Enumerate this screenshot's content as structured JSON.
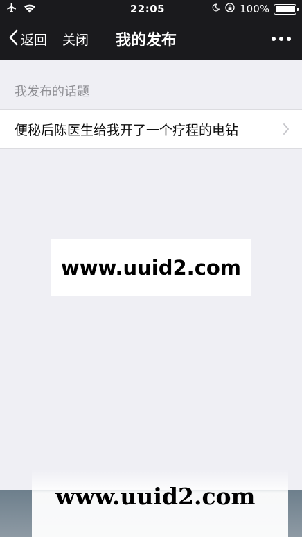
{
  "status_bar": {
    "time": "22:05",
    "battery": "100%",
    "icons": [
      "airplane-icon",
      "wifi-icon",
      "moon-icon",
      "orientation-lock-icon",
      "battery-icon"
    ]
  },
  "nav": {
    "back_label": "返回",
    "close_label": "关闭",
    "title": "我的发布",
    "more_icon": "more-icon"
  },
  "section": {
    "header": "我发布的话题",
    "items": [
      {
        "label": "便秘后陈医生给我开了一个疗程的电钻"
      }
    ]
  },
  "watermarks": {
    "center": "www.uuid2.com",
    "bottom": "www.uuid2.com"
  },
  "colors": {
    "nav_bg": "#1a1a1d",
    "page_bg": "#efeff4",
    "secondary_text": "#8e8e93"
  }
}
